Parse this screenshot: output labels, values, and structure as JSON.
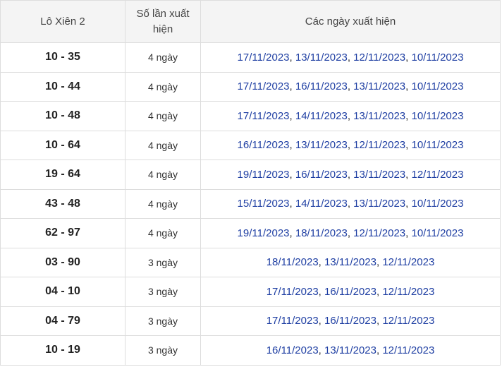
{
  "table": {
    "headers": {
      "pair": "Lô Xiên 2",
      "count": "Số lần xuất hiện",
      "dates": "Các ngày xuất hiện"
    },
    "rows": [
      {
        "pair": "10 - 35",
        "count": "4 ngày",
        "dates": [
          "17/11/2023",
          "13/11/2023",
          "12/11/2023",
          "10/11/2023"
        ]
      },
      {
        "pair": "10 - 44",
        "count": "4 ngày",
        "dates": [
          "17/11/2023",
          "16/11/2023",
          "13/11/2023",
          "10/11/2023"
        ]
      },
      {
        "pair": "10 - 48",
        "count": "4 ngày",
        "dates": [
          "17/11/2023",
          "14/11/2023",
          "13/11/2023",
          "10/11/2023"
        ]
      },
      {
        "pair": "10 - 64",
        "count": "4 ngày",
        "dates": [
          "16/11/2023",
          "13/11/2023",
          "12/11/2023",
          "10/11/2023"
        ]
      },
      {
        "pair": "19 - 64",
        "count": "4 ngày",
        "dates": [
          "19/11/2023",
          "16/11/2023",
          "13/11/2023",
          "12/11/2023"
        ]
      },
      {
        "pair": "43 - 48",
        "count": "4 ngày",
        "dates": [
          "15/11/2023",
          "14/11/2023",
          "13/11/2023",
          "10/11/2023"
        ]
      },
      {
        "pair": "62 - 97",
        "count": "4 ngày",
        "dates": [
          "19/11/2023",
          "18/11/2023",
          "12/11/2023",
          "10/11/2023"
        ]
      },
      {
        "pair": "03 - 90",
        "count": "3 ngày",
        "dates": [
          "18/11/2023",
          "13/11/2023",
          "12/11/2023"
        ]
      },
      {
        "pair": "04 - 10",
        "count": "3 ngày",
        "dates": [
          "17/11/2023",
          "16/11/2023",
          "12/11/2023"
        ]
      },
      {
        "pair": "04 - 79",
        "count": "3 ngày",
        "dates": [
          "17/11/2023",
          "16/11/2023",
          "12/11/2023"
        ]
      },
      {
        "pair": "10 - 19",
        "count": "3 ngày",
        "dates": [
          "16/11/2023",
          "13/11/2023",
          "12/11/2023"
        ]
      }
    ]
  },
  "colors": {
    "date_link": "#1f3fa3",
    "header_bg": "#f4f4f4",
    "border": "#dddddd"
  }
}
